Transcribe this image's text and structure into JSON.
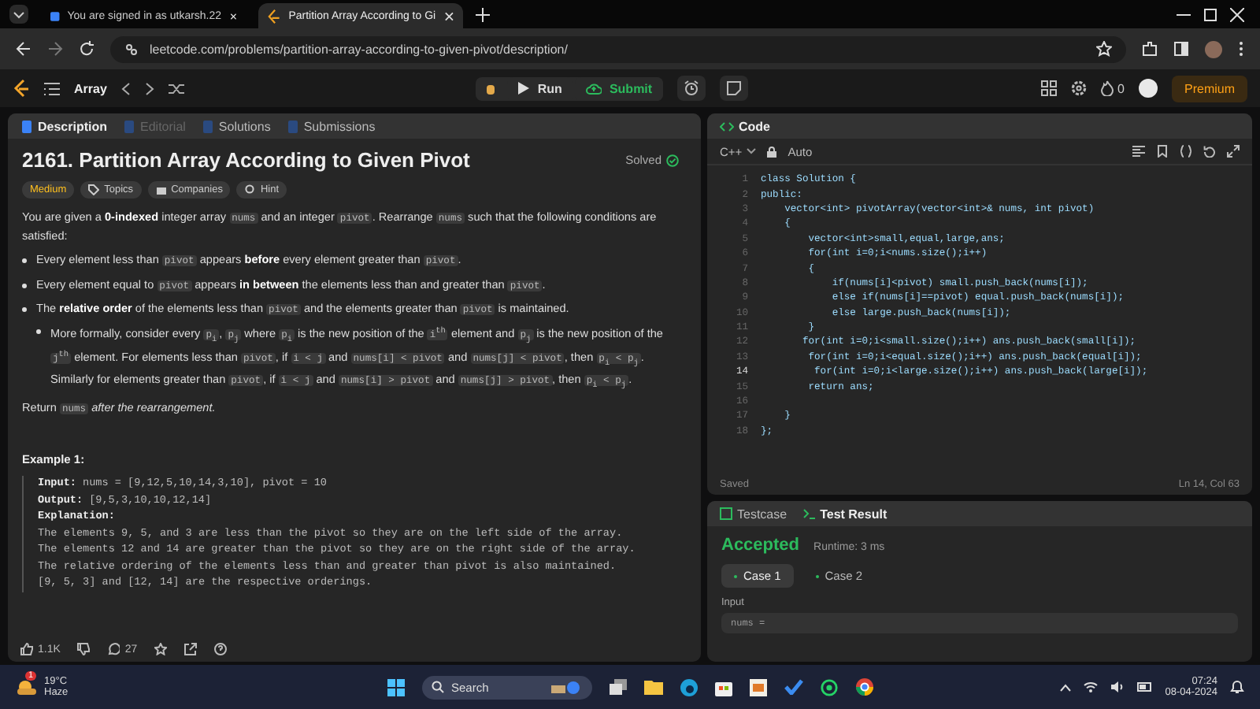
{
  "browser": {
    "tabs": [
      {
        "title": "You are signed in as utkarsh.22",
        "selected": false
      },
      {
        "title": "Partition Array According to Gi",
        "selected": true
      }
    ],
    "url": "leetcode.com/problems/partition-array-according-to-given-pivot/description/"
  },
  "nav": {
    "list_label": "Array",
    "run": "Run",
    "submit": "Submit",
    "streak": "0",
    "premium": "Premium"
  },
  "description_panel": {
    "tabs": [
      {
        "label": "Description",
        "selected": true,
        "disabled": false
      },
      {
        "label": "Editorial",
        "selected": false,
        "disabled": true
      },
      {
        "label": "Solutions",
        "selected": false,
        "disabled": false
      },
      {
        "label": "Submissions",
        "selected": false,
        "disabled": false
      }
    ],
    "title": "2161. Partition Array According to Given Pivot",
    "status": "Solved",
    "tags": [
      {
        "label": "Medium",
        "kind": "difficulty"
      },
      {
        "label": "Topics",
        "kind": "topics"
      },
      {
        "label": "Companies",
        "kind": "companies"
      },
      {
        "label": "Hint",
        "kind": "hint"
      }
    ],
    "intro": [
      {
        "kind": "text",
        "t": "You are given a "
      },
      {
        "kind": "bold",
        "t": "0-indexed"
      },
      {
        "kind": "text",
        "t": " integer array "
      },
      {
        "kind": "code",
        "t": "nums"
      },
      {
        "kind": "text",
        "t": " and an integer "
      },
      {
        "kind": "code",
        "t": "pivot"
      },
      {
        "kind": "text",
        "t": ". Rearrange "
      },
      {
        "kind": "code",
        "t": "nums"
      },
      {
        "kind": "text",
        "t": " such that the following conditions are satisfied:"
      }
    ],
    "bullets": [
      {
        "segments": [
          {
            "kind": "text",
            "t": "Every element less than "
          },
          {
            "kind": "code",
            "t": "pivot"
          },
          {
            "kind": "text",
            "t": " appears "
          },
          {
            "kind": "bold",
            "t": "before"
          },
          {
            "kind": "text",
            "t": " every element greater than "
          },
          {
            "kind": "code",
            "t": "pivot"
          },
          {
            "kind": "text",
            "t": "."
          }
        ]
      },
      {
        "segments": [
          {
            "kind": "text",
            "t": "Every element equal to "
          },
          {
            "kind": "code",
            "t": "pivot"
          },
          {
            "kind": "text",
            "t": " appears "
          },
          {
            "kind": "bold",
            "t": "in between"
          },
          {
            "kind": "text",
            "t": " the elements less than and greater than "
          },
          {
            "kind": "code",
            "t": "pivot"
          },
          {
            "kind": "text",
            "t": "."
          }
        ]
      },
      {
        "segments": [
          {
            "kind": "text",
            "t": "The "
          },
          {
            "kind": "bold",
            "t": "relative order"
          },
          {
            "kind": "text",
            "t": " of the elements less than "
          },
          {
            "kind": "code",
            "t": "pivot"
          },
          {
            "kind": "text",
            "t": " and the elements greater than "
          },
          {
            "kind": "code",
            "t": "pivot"
          },
          {
            "kind": "text",
            "t": " is maintained."
          }
        ],
        "children": [
          {
            "segments": [
              {
                "kind": "text",
                "t": "More formally, consider every "
              },
              {
                "kind": "code",
                "t": "p$_{i}$"
              },
              {
                "kind": "text",
                "t": ", "
              },
              {
                "kind": "code",
                "t": "p$_{j}$"
              },
              {
                "kind": "text",
                "t": " where "
              },
              {
                "kind": "code",
                "t": "p$_{i}$"
              },
              {
                "kind": "text",
                "t": " is the new position of the "
              },
              {
                "kind": "code",
                "t": "i$^{th}$"
              },
              {
                "kind": "text",
                "t": " element and "
              },
              {
                "kind": "code",
                "t": "p$_{j}$"
              },
              {
                "kind": "text",
                "t": " is the new position of the "
              },
              {
                "kind": "code",
                "t": "j$^{th}$"
              },
              {
                "kind": "text",
                "t": " element. For elements less than "
              },
              {
                "kind": "code",
                "t": "pivot"
              },
              {
                "kind": "text",
                "t": ", if "
              },
              {
                "kind": "code",
                "t": "i < j"
              },
              {
                "kind": "text",
                "t": " and "
              },
              {
                "kind": "code",
                "t": "nums[i] < pivot"
              },
              {
                "kind": "text",
                "t": " and "
              },
              {
                "kind": "code",
                "t": "nums[j] < pivot"
              },
              {
                "kind": "text",
                "t": ", then "
              },
              {
                "kind": "code",
                "t": "p$_{i}$ < p$_{j}$"
              },
              {
                "kind": "text",
                "t": ". Similarly for elements greater than "
              },
              {
                "kind": "code",
                "t": "pivot"
              },
              {
                "kind": "text",
                "t": ", if "
              },
              {
                "kind": "code",
                "t": "i < j"
              },
              {
                "kind": "text",
                "t": " and "
              },
              {
                "kind": "code",
                "t": "nums[i] > pivot"
              },
              {
                "kind": "text",
                "t": " and "
              },
              {
                "kind": "code",
                "t": "nums[j] > pivot"
              },
              {
                "kind": "text",
                "t": ", then "
              },
              {
                "kind": "code",
                "t": "p$_{i}$ < p$_{j}$"
              },
              {
                "kind": "text",
                "t": "."
              }
            ]
          }
        ]
      }
    ],
    "return_text": [
      {
        "kind": "text",
        "t": "Return "
      },
      {
        "kind": "code",
        "t": "nums"
      },
      {
        "kind": "italic",
        "t": " after the rearrangement."
      }
    ],
    "example": {
      "heading": "Example 1:",
      "fields": [
        {
          "label": "Input:",
          "text": "nums = [9,12,5,10,14,3,10], pivot = 10"
        },
        {
          "label": "Output:",
          "text": "[9,5,3,10,10,12,14]"
        },
        {
          "label": "Explanation:"
        }
      ],
      "explanation": [
        "The elements 9, 5, and 3 are less than the pivot so they are on the left side of the array.",
        "The elements 12 and 14 are greater than the pivot so they are on the right side of the array.",
        "The relative ordering of the elements less than and greater than pivot is also maintained.",
        "[9, 5, 3] and [12, 14] are the respective orderings."
      ]
    },
    "likes": "1.1K",
    "comments": "27"
  },
  "code_panel": {
    "title": "Code",
    "language": "C++",
    "mode": "Auto",
    "lines": [
      {
        "n": "1",
        "text": "class Solution {",
        "active": false
      },
      {
        "n": "2",
        "text": "public:",
        "active": false
      },
      {
        "n": "3",
        "text": "    vector<int> pivotArray(vector<int>& nums, int pivot)",
        "active": false
      },
      {
        "n": "4",
        "text": "    {",
        "active": false
      },
      {
        "n": "5",
        "text": "        vector<int>small,equal,large,ans;",
        "active": false
      },
      {
        "n": "6",
        "text": "        for(int i=0;i<nums.size();i++)",
        "active": false
      },
      {
        "n": "7",
        "text": "        {",
        "active": false
      },
      {
        "n": "8",
        "text": "            if(nums[i]<pivot) small.push_back(nums[i]);",
        "active": false
      },
      {
        "n": "9",
        "text": "            else if(nums[i]==pivot) equal.push_back(nums[i]);",
        "active": false
      },
      {
        "n": "10",
        "text": "            else large.push_back(nums[i]);",
        "active": false
      },
      {
        "n": "11",
        "text": "        }",
        "active": false
      },
      {
        "n": "12",
        "text": "       for(int i=0;i<small.size();i++) ans.push_back(small[i]);",
        "active": false
      },
      {
        "n": "13",
        "text": "        for(int i=0;i<equal.size();i++) ans.push_back(equal[i]);",
        "active": false
      },
      {
        "n": "14",
        "text": "         for(int i=0;i<large.size();i++) ans.push_back(large[i]);",
        "active": true
      },
      {
        "n": "15",
        "text": "        return ans;",
        "active": false
      },
      {
        "n": "16",
        "active": false
      },
      {
        "n": "17",
        "text": "    }",
        "active": false
      },
      {
        "n": "18",
        "text": "};",
        "active": false
      }
    ],
    "saved": "Saved",
    "cursor": "Ln 14, Col 63"
  },
  "test_panel": {
    "tabs": [
      {
        "label": "Testcase",
        "selected": false
      },
      {
        "label": "Test Result",
        "selected": true
      }
    ],
    "verdict": "Accepted",
    "runtime": "Runtime: 3 ms",
    "cases": [
      {
        "label": "Case 1",
        "selected": true
      },
      {
        "label": "Case 2",
        "selected": false
      }
    ],
    "input_label": "Input",
    "input_value": "nums ="
  },
  "taskbar": {
    "temperature": "19°C",
    "weather": "Haze",
    "weather_badge": "1",
    "search": "Search",
    "time": "07:24",
    "date": "08-04-2024"
  }
}
